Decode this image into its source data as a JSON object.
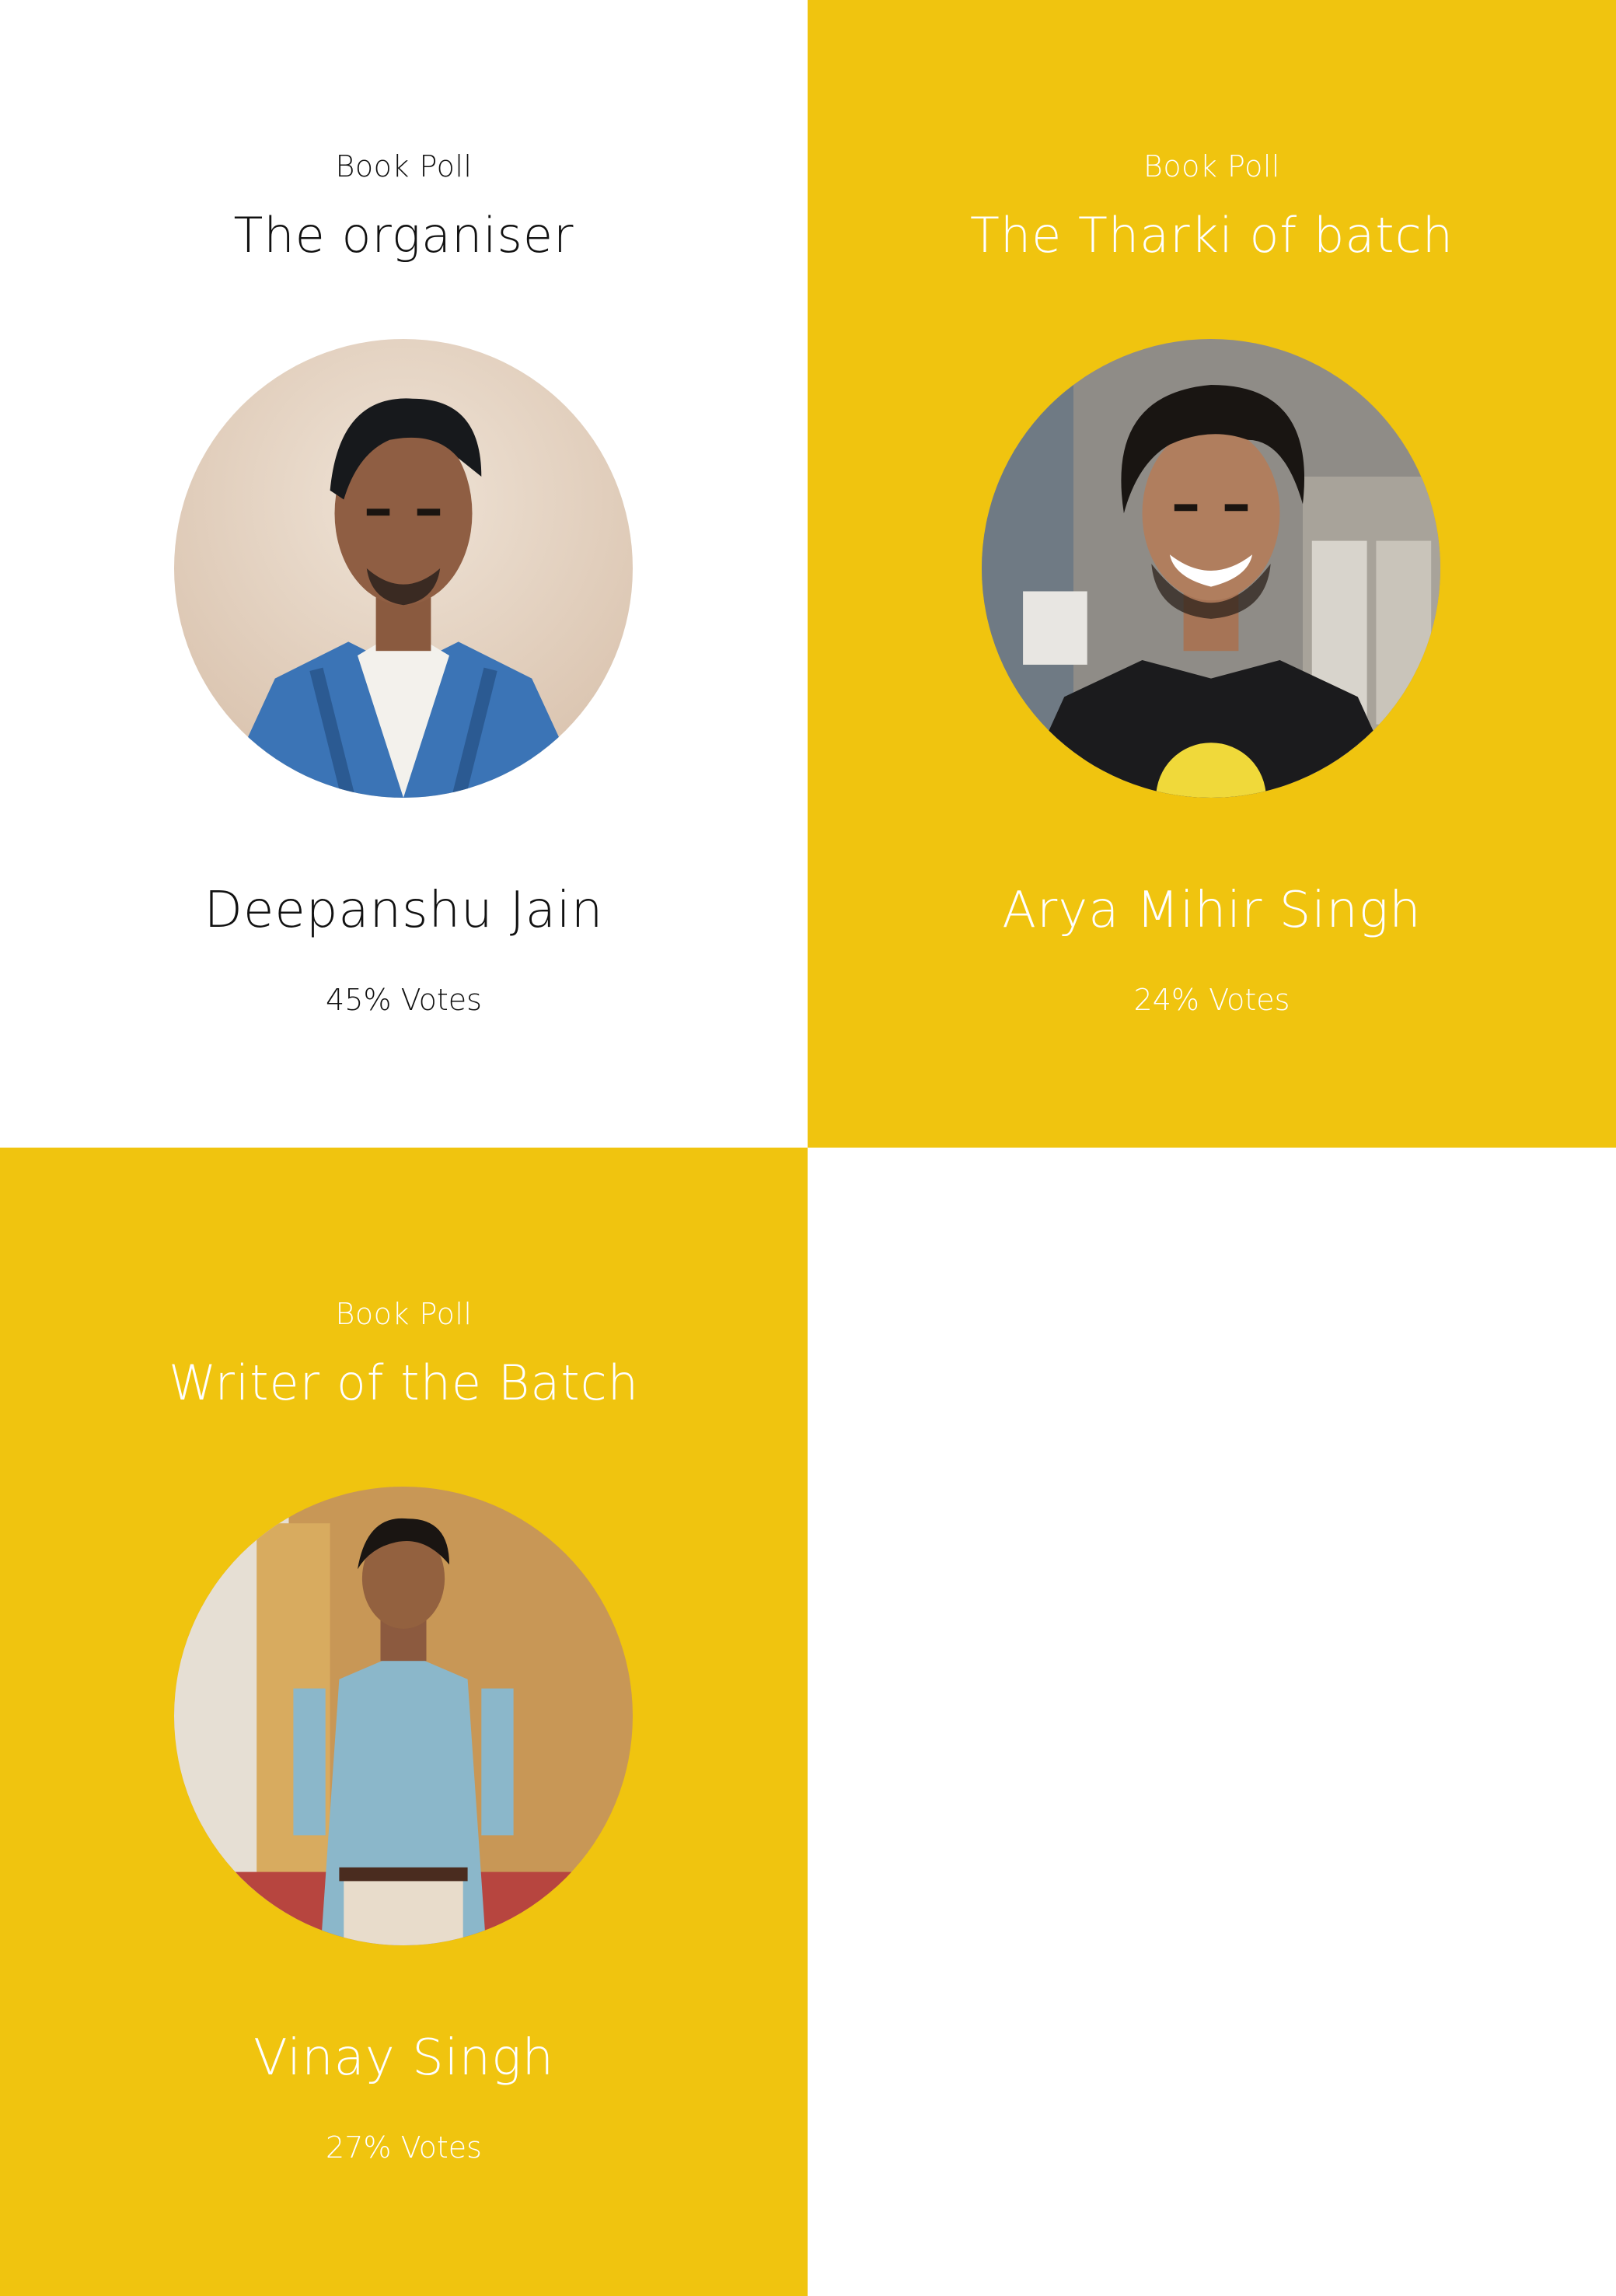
{
  "colors": {
    "accent": "#f0c40f",
    "white": "#ffffff",
    "text_dark": "#111111"
  },
  "cards": [
    {
      "kicker": "Book Poll",
      "title": "The organiser",
      "name": "Deepanshu Jain",
      "votes_value": "45%",
      "votes_label": "Votes",
      "theme": "white"
    },
    {
      "kicker": "Book Poll",
      "title": "The Tharki of batch",
      "name": "Arya Mihir Singh",
      "votes_value": "24%",
      "votes_label": "Votes",
      "theme": "yellow"
    },
    {
      "kicker": "Book Poll",
      "title": "Writer of the Batch",
      "name": "Vinay Singh",
      "votes_value": "27%",
      "votes_label": "Votes",
      "theme": "yellow"
    }
  ]
}
